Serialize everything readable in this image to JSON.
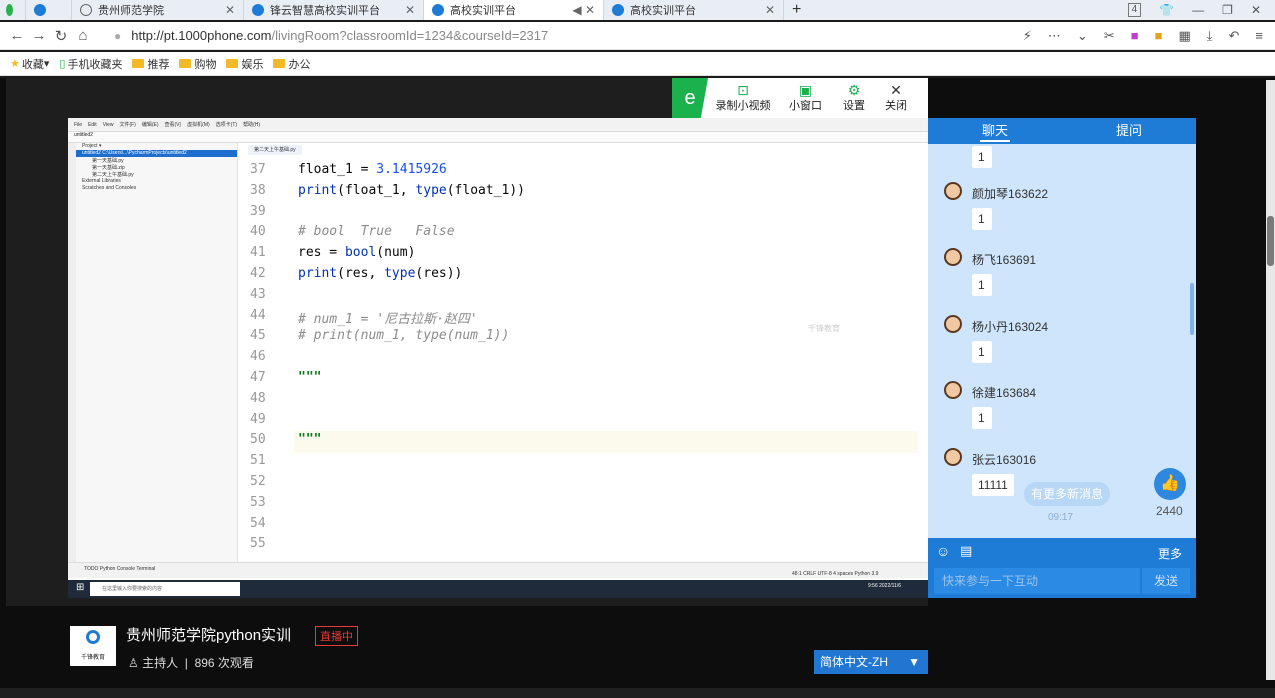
{
  "browser": {
    "tabs": [
      {
        "label": "贵州师范学院",
        "active": false
      },
      {
        "label": "锋云智慧高校实训平台",
        "active": false
      },
      {
        "label": "高校实训平台",
        "active": true
      },
      {
        "label": "高校实训平台",
        "active": false
      }
    ],
    "url_host": "http://pt.1000phone.com",
    "url_path": "/livingRoom?classroomId=1234&courseId=2317",
    "bookmarks": [
      "收藏",
      "手机收藏夹",
      "推荐",
      "购物",
      "娱乐",
      "办公"
    ],
    "tab_count": "4"
  },
  "overlay": {
    "record": "录制小视频",
    "mini": "小窗口",
    "settings": "设置",
    "close": "关闭"
  },
  "ide": {
    "menu": [
      "File",
      "Edit",
      "View",
      "文件(F)",
      "编辑(E)",
      "查看(V)",
      "虚拟机(M)",
      "选项卡(T)",
      "帮助(H)"
    ],
    "project": "untitled2",
    "tree": [
      "Project ▾",
      "untitled2 C:\\Users\\...\\PycharmProjects\\untitled2",
      "第一天基础.py",
      "第一天基础.zip",
      "第二天上午基础.py",
      "External Libraries",
      "Scratches and Consoles"
    ],
    "file_tab": "第二天上午基础.py",
    "watermark": "千锋教育",
    "lines": [
      {
        "n": "37",
        "code": "float_1 = 3.1415926"
      },
      {
        "n": "38",
        "code": "print(float_1, type(float_1))"
      },
      {
        "n": "39",
        "code": ""
      },
      {
        "n": "40",
        "code": "# bool  True   False"
      },
      {
        "n": "41",
        "code": "res = bool(num)"
      },
      {
        "n": "42",
        "code": "print(res, type(res))"
      },
      {
        "n": "43",
        "code": ""
      },
      {
        "n": "44",
        "code": "# num_1 = '尼古拉斯·赵四'"
      },
      {
        "n": "45",
        "code": "# print(num_1, type(num_1))"
      },
      {
        "n": "46",
        "code": ""
      },
      {
        "n": "47",
        "code": "\"\"\""
      },
      {
        "n": "48",
        "code": ""
      },
      {
        "n": "49",
        "code": ""
      },
      {
        "n": "50",
        "code": "\"\"\""
      },
      {
        "n": "51",
        "code": ""
      },
      {
        "n": "52",
        "code": ""
      },
      {
        "n": "53",
        "code": ""
      },
      {
        "n": "54",
        "code": ""
      },
      {
        "n": "55",
        "code": ""
      }
    ],
    "status": "48:1  CRLF  UTF-8  4 spaces  Python 3.9",
    "bottom_tabs": "TODO   Python Console   Terminal",
    "search_placeholder": "在这里输入你要搜索的内容",
    "clock": "9:56 2022/11/6"
  },
  "chat": {
    "tabs": [
      "聊天",
      "提问"
    ],
    "messages": [
      {
        "name": "",
        "text": "1"
      },
      {
        "name": "颜加琴163622",
        "text": "1"
      },
      {
        "name": "杨飞163691",
        "text": "1"
      },
      {
        "name": "杨小丹163024",
        "text": "1"
      },
      {
        "name": "徐建163684",
        "text": "1"
      },
      {
        "name": "张云163016",
        "text": "11111"
      }
    ],
    "new_messages": "有更多新消息",
    "time": "09:17",
    "likes": "2440",
    "more": "更多",
    "input_placeholder": "快来参与一下互动",
    "send": "发送"
  },
  "info": {
    "title": "贵州师范学院python实训",
    "live": "直播中",
    "host": "主持人",
    "views": "896 次观看",
    "logo_text": "千锋教育",
    "language": "简体中文-ZH"
  }
}
